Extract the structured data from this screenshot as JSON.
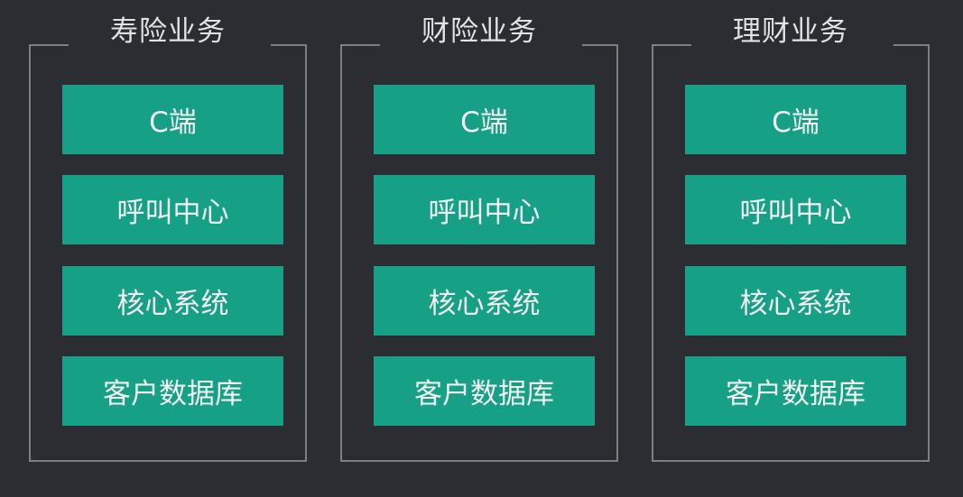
{
  "colors": {
    "background": "#2c2d32",
    "box_fill": "#16a085",
    "frame": "#7f7f80",
    "text": "#f2f2f2"
  },
  "groups": [
    {
      "title": "寿险业务",
      "items": [
        "C端",
        "呼叫中心",
        "核心系统",
        "客户数据库"
      ]
    },
    {
      "title": "财险业务",
      "items": [
        "C端",
        "呼叫中心",
        "核心系统",
        "客户数据库"
      ]
    },
    {
      "title": "理财业务",
      "items": [
        "C端",
        "呼叫中心",
        "核心系统",
        "客户数据库"
      ]
    }
  ]
}
